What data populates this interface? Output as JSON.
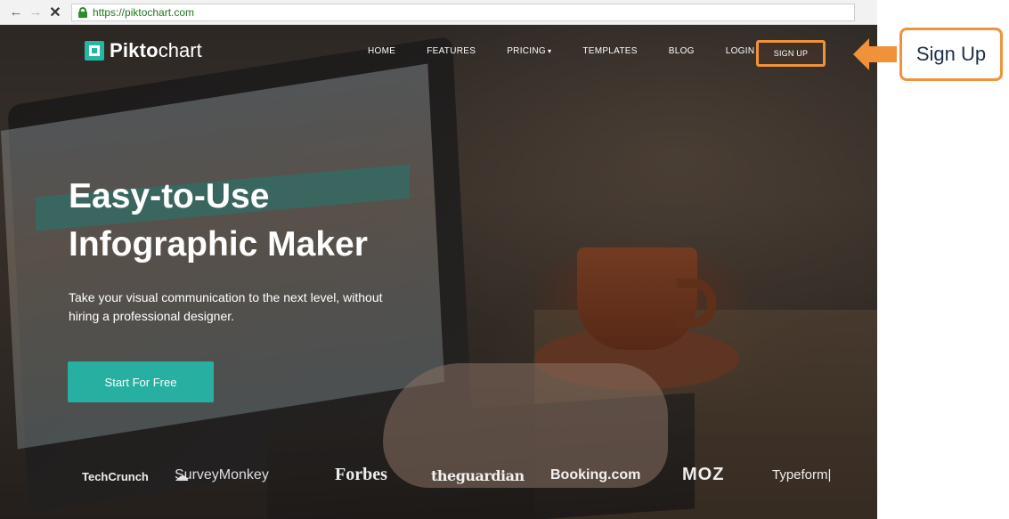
{
  "browser": {
    "url": "https://piktochart.com"
  },
  "header": {
    "logo_bold": "Pikto",
    "logo_light": "chart",
    "nav": [
      {
        "label": "HOME"
      },
      {
        "label": "FEATURES"
      },
      {
        "label": "PRICING"
      },
      {
        "label": "TEMPLATES"
      },
      {
        "label": "BLOG"
      },
      {
        "label": "LOGIN"
      }
    ],
    "pricing_caret": "▾",
    "signup_label": "SIGN UP"
  },
  "hero": {
    "title_line1": "Easy-to-Use",
    "title_line2": "Infographic Maker",
    "subtitle": "Take your visual communication to the next level, without hiring a professional designer.",
    "cta_label": "Start For Free"
  },
  "press": {
    "techcrunch": "TechCrunch",
    "surveymonkey": "SurveyMonkey",
    "forbes": "Forbes",
    "guardian": "theguardian",
    "booking": "Booking.com",
    "moz": "MOZ",
    "typeform": "Typeform|"
  },
  "annotation": {
    "callout_label": "Sign Up"
  },
  "colors": {
    "accent_teal": "#27b0a1",
    "highlight_orange": "#f0923a"
  }
}
